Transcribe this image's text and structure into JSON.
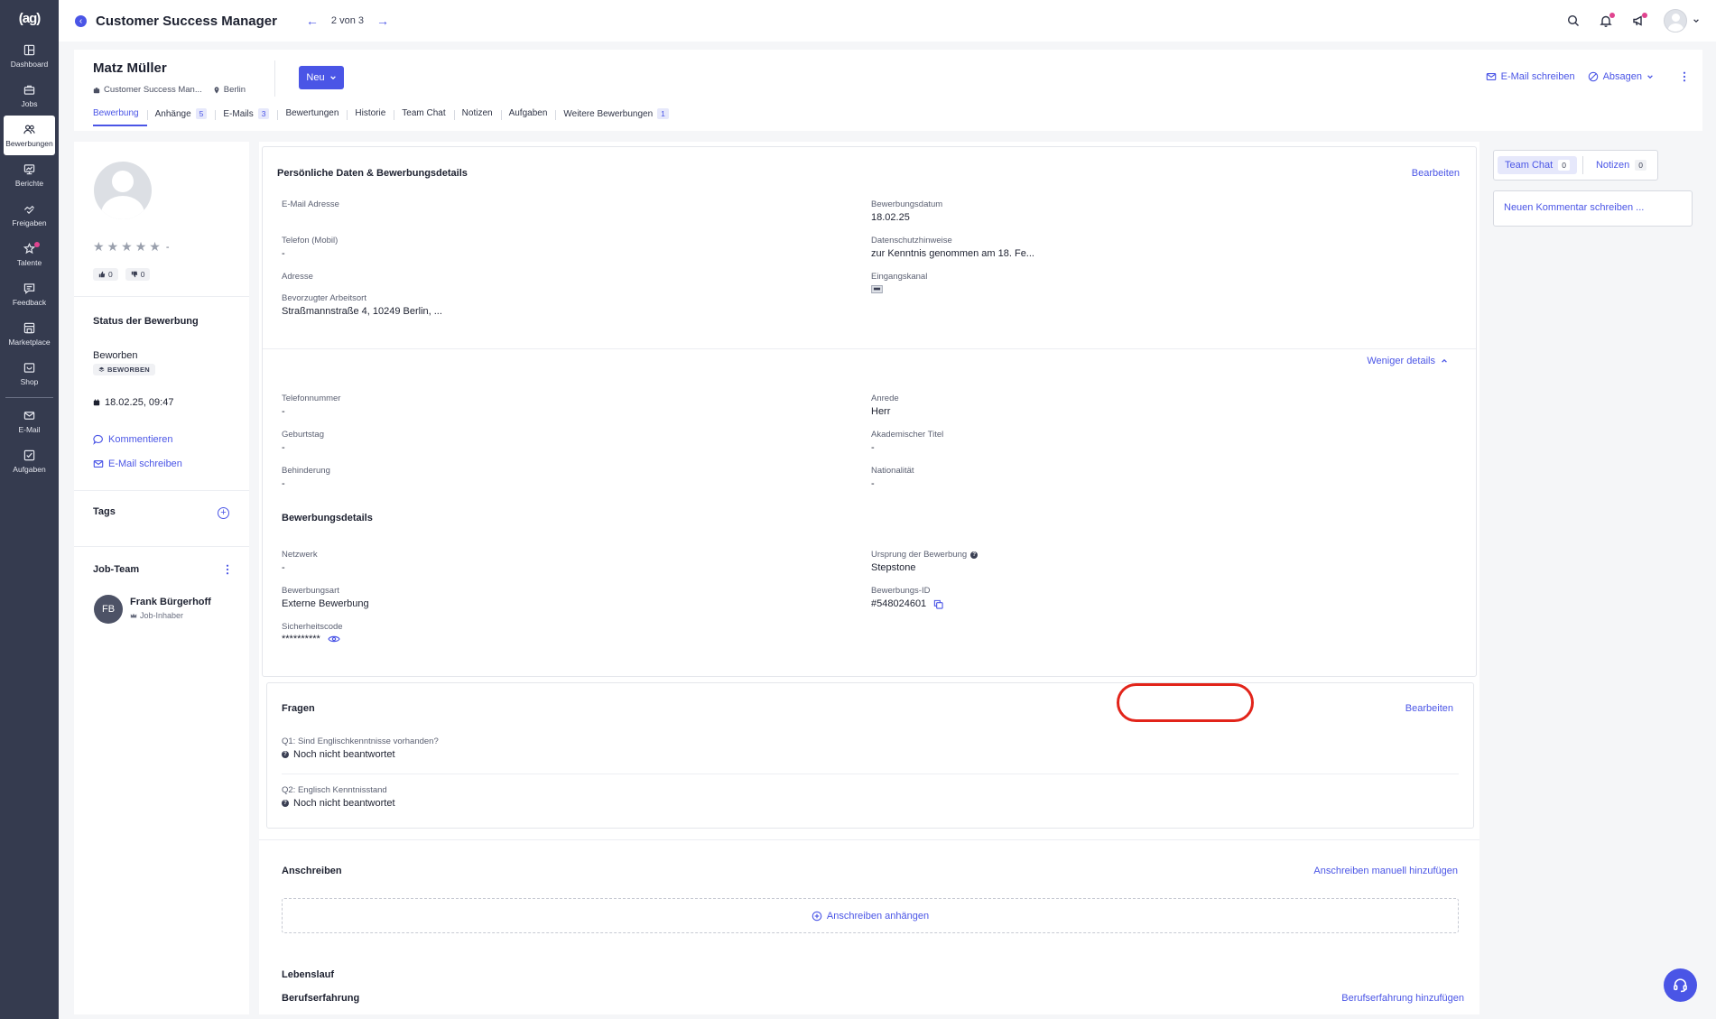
{
  "app": {
    "logo": "(ag)"
  },
  "nav": {
    "items": [
      {
        "label": "Dashboard"
      },
      {
        "label": "Jobs"
      },
      {
        "label": "Bewerbungen"
      },
      {
        "label": "Berichte"
      },
      {
        "label": "Freigaben"
      },
      {
        "label": "Talente"
      },
      {
        "label": "Feedback"
      },
      {
        "label": "Marketplace"
      },
      {
        "label": "Shop"
      },
      {
        "label": "E-Mail"
      },
      {
        "label": "Aufgaben"
      }
    ]
  },
  "topbar": {
    "title": "Customer Success Manager",
    "pager": "2 von 3"
  },
  "candidate": {
    "name": "Matz Müller",
    "job": "Customer Success Man...",
    "location": "Berlin",
    "new_button": "Neu",
    "email_action": "E-Mail schreiben",
    "reject_action": "Absagen"
  },
  "tabs": [
    {
      "label": "Bewerbung",
      "count": ""
    },
    {
      "label": "Anhänge",
      "count": "5"
    },
    {
      "label": "E-Mails",
      "count": "3"
    },
    {
      "label": "Bewertungen",
      "count": ""
    },
    {
      "label": "Historie",
      "count": ""
    },
    {
      "label": "Team Chat",
      "count": ""
    },
    {
      "label": "Notizen",
      "count": ""
    },
    {
      "label": "Aufgaben",
      "count": ""
    },
    {
      "label": "Weitere Bewerbungen",
      "count": "1"
    }
  ],
  "profile": {
    "rating_dash": "-",
    "upvotes": "0",
    "downvotes": "0",
    "status_title": "Status der Bewerbung",
    "status_text": "Beworben",
    "status_badge": "BEWORBEN",
    "status_date": "18.02.25, 09:47",
    "comment_link": "Kommentieren",
    "email_link": "E-Mail schreiben",
    "tags_title": "Tags",
    "team_title": "Job-Team",
    "team_member": {
      "initials": "FB",
      "name": "Frank Bürgerhoff",
      "role": "Job-Inhaber"
    }
  },
  "personal": {
    "title": "Persönliche Daten & Bewerbungsdetails",
    "edit": "Bearbeiten",
    "fields_left": [
      {
        "label": "E-Mail Adresse",
        "value": ""
      },
      {
        "label": "Telefon (Mobil)",
        "value": "-"
      },
      {
        "label": "Adresse",
        "value": ""
      },
      {
        "label": "Bevorzugter Arbeitsort",
        "value": "Straßmannstraße 4, 10249 Berlin, ..."
      }
    ],
    "fields_right": [
      {
        "label": "Bewerbungsdatum",
        "value": "18.02.25"
      },
      {
        "label": "Datenschutzhinweise",
        "value": "zur Kenntnis genommen am 18. Fe..."
      },
      {
        "label": "Eingangskanal",
        "value": ""
      }
    ],
    "less_details": "Weniger details",
    "extra_left": [
      {
        "label": "Telefonnummer",
        "value": "-"
      },
      {
        "label": "Geburtstag",
        "value": "-"
      },
      {
        "label": "Behinderung",
        "value": "-"
      }
    ],
    "extra_right": [
      {
        "label": "Anrede",
        "value": "Herr"
      },
      {
        "label": "Akademischer Titel",
        "value": "-"
      },
      {
        "label": "Nationalität",
        "value": "-"
      }
    ],
    "details_title": "Bewerbungsdetails",
    "details_left": [
      {
        "label": "Netzwerk",
        "value": "-"
      },
      {
        "label": "Bewerbungsart",
        "value": "Externe Bewerbung"
      },
      {
        "label": "Sicherheitscode",
        "value": "**********"
      }
    ],
    "details_right": [
      {
        "label": "Ursprung der Bewerbung",
        "value": "Stepstone"
      },
      {
        "label": "Bewerbungs-ID",
        "value": "#548024601"
      }
    ]
  },
  "questions": {
    "title": "Fragen",
    "edit": "Bearbeiten",
    "items": [
      {
        "q": "Q1: Sind Englischkenntnisse vorhanden?",
        "a": "Noch nicht beantwortet"
      },
      {
        "q": "Q2: Englisch Kenntnisstand",
        "a": "Noch nicht beantwortet"
      }
    ]
  },
  "cover": {
    "title": "Anschreiben",
    "add_manual": "Anschreiben manuell hinzufügen",
    "attach": "Anschreiben anhängen"
  },
  "cv": {
    "title": "Lebenslauf",
    "experience": "Berufserfahrung",
    "add_experience": "Berufserfahrung hinzufügen"
  },
  "side": {
    "tab_chat": "Team Chat",
    "tab_chat_count": "0",
    "tab_notes": "Notizen",
    "tab_notes_count": "0",
    "comment_placeholder": "Neuen Kommentar schreiben ..."
  },
  "colors": {
    "accent": "#4a55e6",
    "nav_bg": "#353b4f",
    "highlight": "#e2241a",
    "notification": "#e0448f"
  }
}
